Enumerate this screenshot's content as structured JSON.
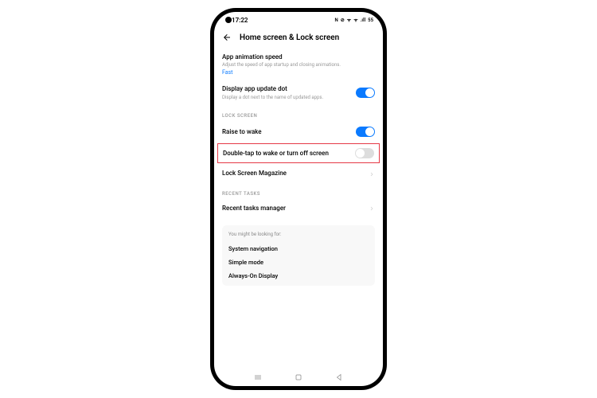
{
  "status": {
    "time": "17:22",
    "icons": [
      "N",
      "⊘",
      "ᯤ",
      "ᯤ",
      ".ıll",
      "55"
    ]
  },
  "header": {
    "title": "Home screen & Lock screen"
  },
  "settings": {
    "appAnimation": {
      "title": "App animation speed",
      "desc": "Adjust the speed of app startup and closing animations.",
      "value": "Fast"
    },
    "updateDot": {
      "title": "Display app update dot",
      "desc": "Display a dot next to the name of updated apps."
    },
    "lockScreenHeader": "LOCK SCREEN",
    "raiseToWake": {
      "title": "Raise to wake"
    },
    "doubleTap": {
      "title": "Double-tap to wake or turn off screen"
    },
    "lockScreenMagazine": {
      "title": "Lock Screen Magazine"
    },
    "recentTasksHeader": "RECENT TASKS",
    "recentTasksManager": {
      "title": "Recent tasks manager"
    }
  },
  "suggestions": {
    "header": "You might be looking for:",
    "items": [
      "System navigation",
      "Simple mode",
      "Always-On Display"
    ]
  }
}
